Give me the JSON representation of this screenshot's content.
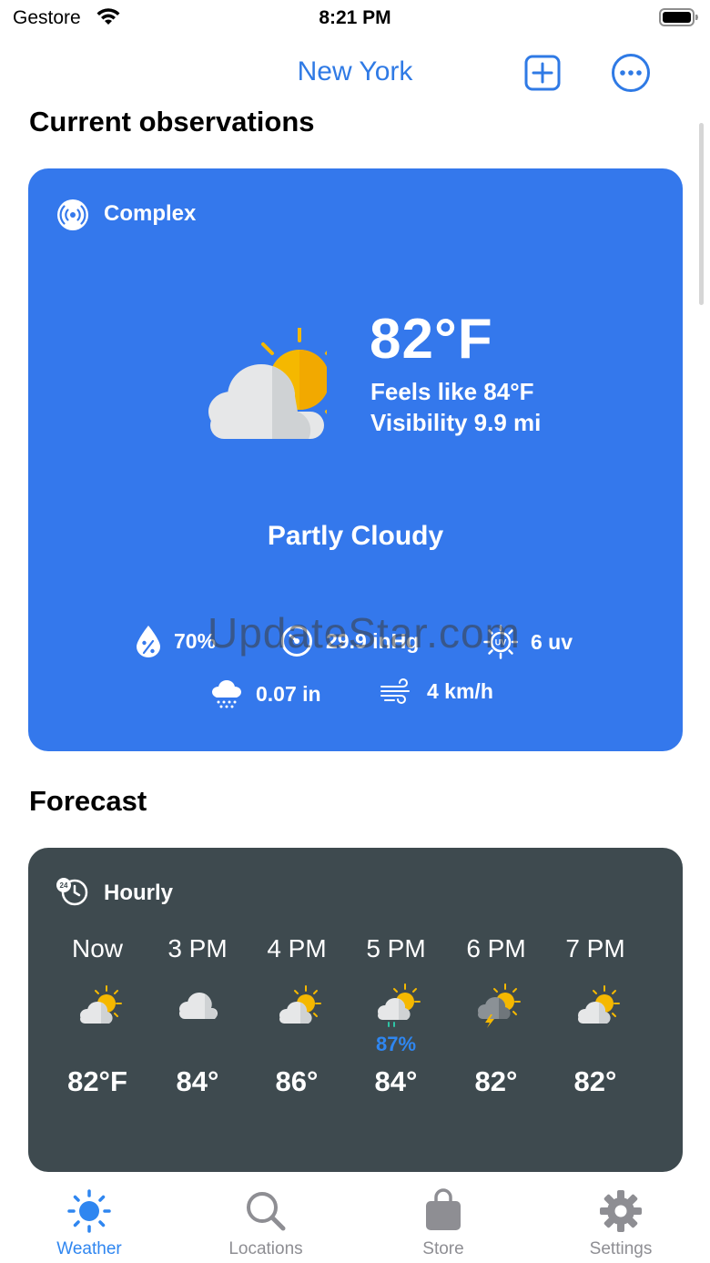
{
  "status_bar": {
    "carrier": "Gestore",
    "time": "8:21 PM"
  },
  "nav": {
    "title": "New York",
    "add_icon": "plus-square-icon",
    "more_icon": "ellipsis-circle-icon"
  },
  "current": {
    "section_title": "Current observations",
    "source_label": "Complex",
    "temperature": "82°F",
    "feels_like": "Feels like 84°F",
    "visibility": "Visibility 9.9 mi",
    "condition": "Partly Cloudy",
    "humidity": "70%",
    "pressure": "29.9 inHg",
    "uv": "6 uv",
    "precipitation": "0.07 in",
    "wind": "4 km/h"
  },
  "watermark": "UpdateStar.com",
  "forecast": {
    "section_title": "Forecast",
    "label": "Hourly",
    "hours": [
      {
        "time": "Now",
        "icon": "partly-cloudy-icon",
        "precip": "",
        "temp": "82°F"
      },
      {
        "time": "3 PM",
        "icon": "cloudy-icon",
        "precip": "",
        "temp": "84°"
      },
      {
        "time": "4 PM",
        "icon": "partly-cloudy-icon",
        "precip": "",
        "temp": "86°"
      },
      {
        "time": "5 PM",
        "icon": "partly-cloudy-rain-icon",
        "precip": "87%",
        "temp": "84°"
      },
      {
        "time": "6 PM",
        "icon": "partly-cloudy-thunder-icon",
        "precip": "",
        "temp": "82°"
      },
      {
        "time": "7 PM",
        "icon": "partly-cloudy-icon",
        "precip": "",
        "temp": "82°"
      }
    ]
  },
  "tabs": [
    {
      "label": "Weather",
      "icon": "sun-icon",
      "active": true
    },
    {
      "label": "Locations",
      "icon": "search-icon",
      "active": false
    },
    {
      "label": "Store",
      "icon": "bag-icon",
      "active": false
    },
    {
      "label": "Settings",
      "icon": "gear-icon",
      "active": false
    }
  ],
  "colors": {
    "accent": "#2f7ae5",
    "current_card": "#3478ec",
    "forecast_card": "#3e4a4f",
    "sun": "#f5b800",
    "cloud": "#e6e7e8",
    "precip_text": "#2f86f0",
    "tab_inactive": "#8e8e93"
  }
}
